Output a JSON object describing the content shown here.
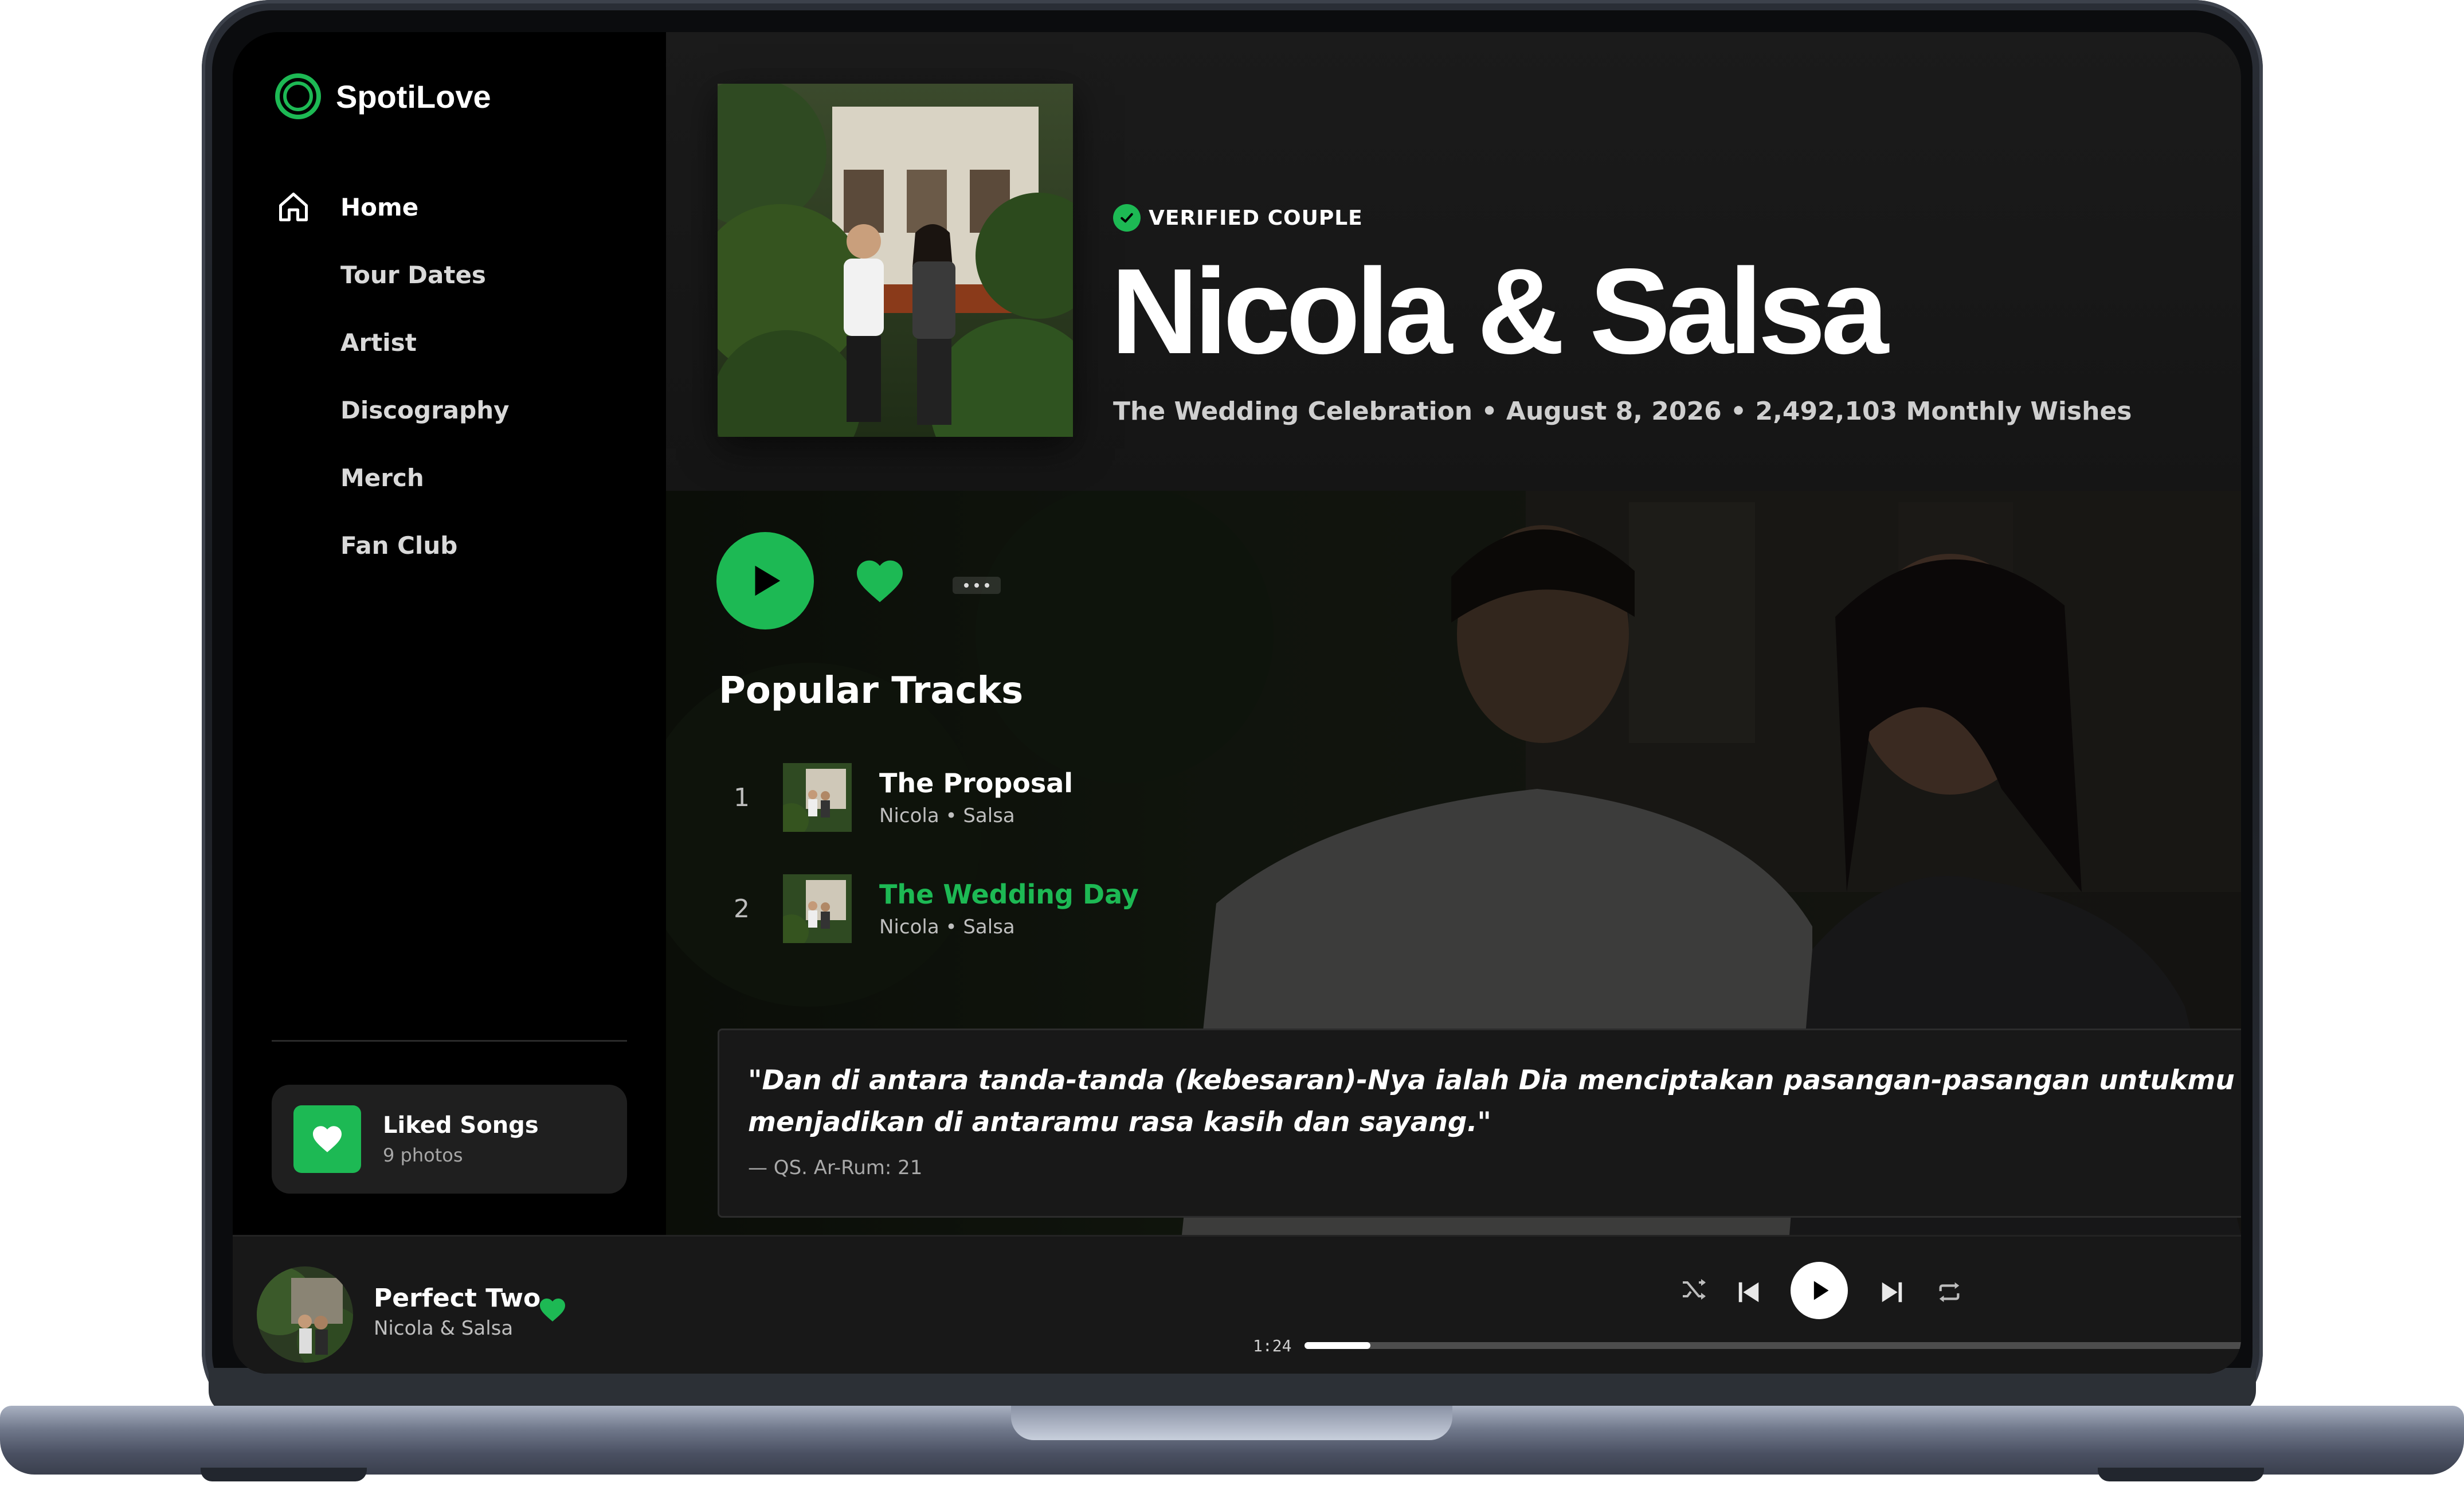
{
  "app": {
    "name": "SpotiLove"
  },
  "colors": {
    "accent": "#1db954",
    "background": "#121212",
    "sidebar": "#000000"
  },
  "sidebar": {
    "items": [
      {
        "label": "Home",
        "icon": "home-icon",
        "active": true
      },
      {
        "label": "Tour Dates"
      },
      {
        "label": "Artist"
      },
      {
        "label": "Discography"
      },
      {
        "label": "Merch"
      },
      {
        "label": "Fan Club"
      }
    ],
    "liked": {
      "title": "Liked Songs",
      "subtitle": "9 photos",
      "icon": "heart-icon"
    }
  },
  "artist": {
    "badge": "VERIFIED COUPLE",
    "name": "Nicola & Salsa",
    "meta": "The Wedding Celebration • August 8, 2026 • 2,492,103 Monthly Wishes"
  },
  "actions": {
    "play_icon": "play-icon",
    "like_icon": "heart-icon",
    "more_icon": "more-icon"
  },
  "popular": {
    "title": "Popular Tracks",
    "tracks": [
      {
        "num": "1",
        "name": "The Proposal",
        "artists": "Nicola • Salsa",
        "playing": false
      },
      {
        "num": "2",
        "name": "The Wedding Day",
        "artists": "Nicola • Salsa",
        "playing": true
      }
    ]
  },
  "quote": {
    "text_line1": "\"Dan di antara tanda-tanda (kebesaran)-Nya ialah Dia menciptakan pasangan-pasangan untukmu dari jenismu sendiri, a",
    "text_line2": "menjadikan di antaramu rasa kasih dan sayang.\"",
    "source": "— QS. Ar-Rum: 21"
  },
  "player": {
    "title": "Perfect Two",
    "artist": "Nicola & Salsa",
    "time": "1:24",
    "progress": 0.07,
    "controls": [
      "shuffle-icon",
      "previous-icon",
      "play-icon",
      "next-icon",
      "repeat-icon"
    ]
  }
}
